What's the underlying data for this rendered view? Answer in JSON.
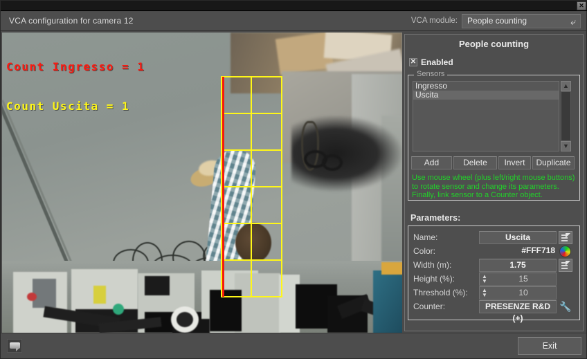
{
  "window": {
    "close_label": "✕"
  },
  "header": {
    "title": "VCA configuration for camera 12",
    "module_label": "VCA module:",
    "module_value": "People counting",
    "module_icon": "curved-arrow-icon"
  },
  "video": {
    "overlay": {
      "line1": "Count Ingresso = 1",
      "line1_color": "#fb1b12",
      "line2": "Count Uscita = 1",
      "line2_color": "#fff718"
    },
    "sensor_shape": {
      "outline_color": "#fff718",
      "direction_edge_color": "#f51a08",
      "columns": 2,
      "rows": 6
    }
  },
  "panel": {
    "title": "People counting",
    "enabled": {
      "label": "Enabled",
      "checked_mark": "✕"
    },
    "sensors_group": {
      "legend": "Sensors",
      "items": [
        {
          "label": "Ingresso",
          "selected": false
        },
        {
          "label": "Uscita",
          "selected": true
        }
      ],
      "buttons": [
        {
          "label": "Add"
        },
        {
          "label": "Delete"
        },
        {
          "label": "Invert"
        },
        {
          "label": "Duplicate"
        }
      ],
      "scroll_up": "▲",
      "scroll_down": "▼"
    },
    "help_text": {
      "line1": "Use mouse wheel (plus left/right mouse buttons)",
      "line2": "to rotate sensor and change its parameters.",
      "line3": "Finally, link sensor to a Counter object.",
      "color": "#22d12a"
    },
    "parameters": {
      "title": "Parameters:",
      "rows": [
        {
          "label": "Name:",
          "value": "Uscita",
          "icon": "edit-icon"
        },
        {
          "label": "Color:",
          "value": "#FFF718",
          "icon": "color-wheel-icon"
        },
        {
          "label": "Width (m):",
          "value": "1.75",
          "icon": "edit-icon"
        },
        {
          "label": "Height (%):",
          "value": "15",
          "icon": "spinner-icon"
        },
        {
          "label": "Threshold (%):",
          "value": "10",
          "icon": "spinner-icon"
        },
        {
          "label": "Counter:",
          "value": "PRESENZE R&D (+)",
          "icon": "wrench-icon"
        }
      ]
    }
  },
  "footer": {
    "message_icon": "message-bubble-icon",
    "exit_label": "Exit"
  }
}
